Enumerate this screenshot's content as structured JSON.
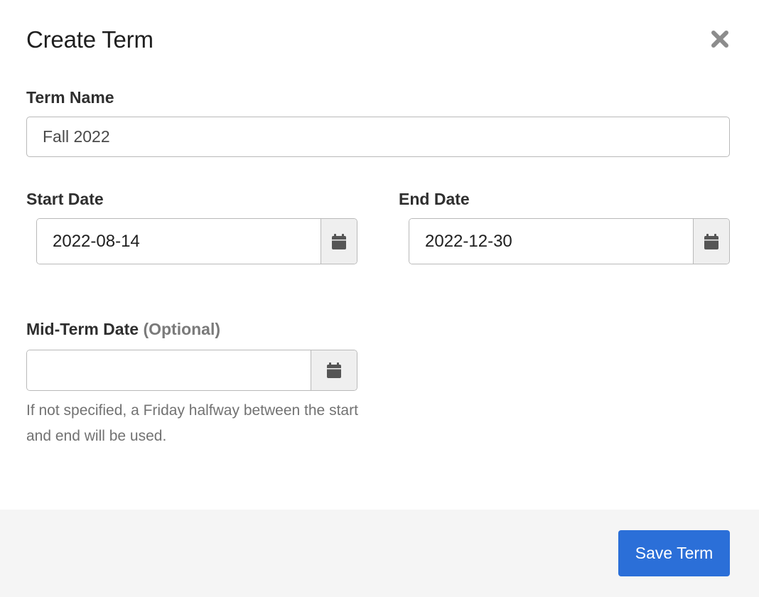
{
  "modal": {
    "title": "Create Term",
    "close_icon": "close-icon"
  },
  "term_name": {
    "label": "Term Name",
    "value": "Fall 2022"
  },
  "start_date": {
    "label": "Start Date",
    "value": "2022-08-14",
    "icon": "calendar-icon"
  },
  "end_date": {
    "label": "End Date",
    "value": "2022-12-30",
    "icon": "calendar-icon"
  },
  "mid_term_date": {
    "label": "Mid-Term Date",
    "optional_label": "(Optional)",
    "value": "",
    "icon": "calendar-icon",
    "help_text": "If not specified, a Friday halfway between the start and end will be used."
  },
  "footer": {
    "save_label": "Save Term"
  },
  "colors": {
    "primary": "#2b6fd8",
    "footer_bg": "#f5f5f5",
    "icon": "#555555"
  }
}
